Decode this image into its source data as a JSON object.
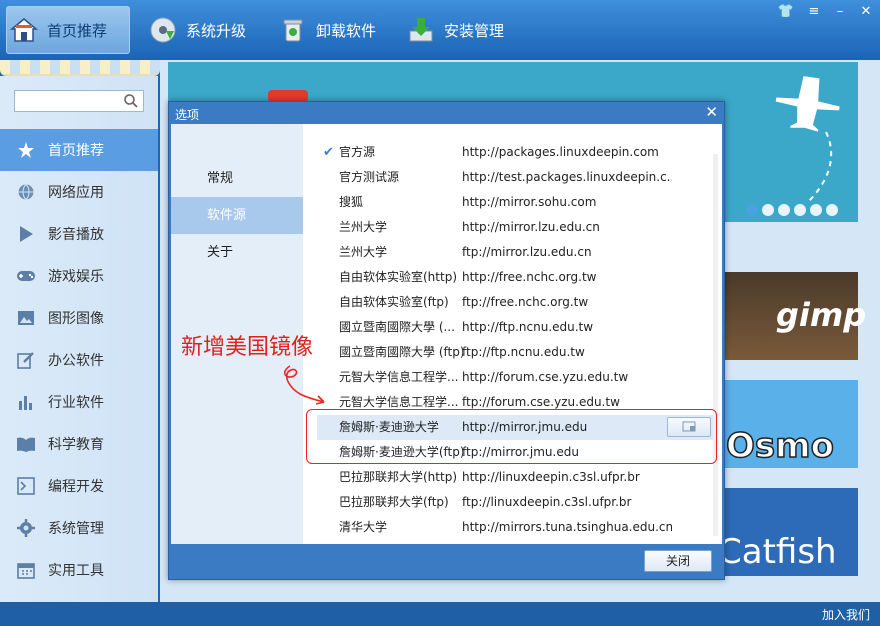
{
  "topbar": {
    "nav": [
      {
        "label": "首页推荐",
        "icon": "home-icon"
      },
      {
        "label": "系统升级",
        "icon": "disc-upgrade-icon"
      },
      {
        "label": "卸载软件",
        "icon": "trash-icon"
      },
      {
        "label": "安装管理",
        "icon": "download-icon"
      }
    ],
    "window_controls": [
      "shirt-icon",
      "menu-icon",
      "minimize-icon",
      "close-icon"
    ]
  },
  "sidebar": {
    "search": {
      "value": "",
      "placeholder": ""
    },
    "items": [
      {
        "label": "首页推荐",
        "icon": "star-icon",
        "active": true
      },
      {
        "label": "网络应用",
        "icon": "globe-icon"
      },
      {
        "label": "影音播放",
        "icon": "play-icon"
      },
      {
        "label": "游戏娱乐",
        "icon": "gamepad-icon"
      },
      {
        "label": "图形图像",
        "icon": "picture-icon"
      },
      {
        "label": "办公软件",
        "icon": "pen-icon"
      },
      {
        "label": "行业软件",
        "icon": "bar-chart-icon"
      },
      {
        "label": "科学教育",
        "icon": "book-icon"
      },
      {
        "label": "编程开发",
        "icon": "terminal-icon"
      },
      {
        "label": "系统管理",
        "icon": "gear-icon"
      },
      {
        "label": "实用工具",
        "icon": "calendar-icon"
      }
    ]
  },
  "thumbnails": [
    "gimp",
    "Osmo",
    "Catfish"
  ],
  "footer": {
    "join": "加入我们"
  },
  "dialog": {
    "title": "选项",
    "tabs": [
      {
        "label": "常规"
      },
      {
        "label": "软件源",
        "active": true
      },
      {
        "label": "关于"
      }
    ],
    "sources": [
      {
        "name": "官方源",
        "url": "http://packages.linuxdeepin.com",
        "checked": true
      },
      {
        "name": "官方测试源",
        "url": "http://test.packages.linuxdeepin.c..."
      },
      {
        "name": "搜狐",
        "url": "http://mirror.sohu.com"
      },
      {
        "name": "兰州大学",
        "url": "http://mirror.lzu.edu.cn"
      },
      {
        "name": "兰州大学",
        "url": "ftp://mirror.lzu.edu.cn"
      },
      {
        "name": "自由软体实验室(http)",
        "url": "http://free.nchc.org.tw"
      },
      {
        "name": "自由软体实验室(ftp)",
        "url": "ftp://free.nchc.org.tw"
      },
      {
        "name": "國立暨南國際大學 (...",
        "url": "http://ftp.ncnu.edu.tw"
      },
      {
        "name": "國立暨南國際大學 (ftp)",
        "url": "ftp://ftp.ncnu.edu.tw"
      },
      {
        "name": "元智大学信息工程学...",
        "url": "http://forum.cse.yzu.edu.tw"
      },
      {
        "name": "元智大学信息工程学...",
        "url": "ftp://forum.cse.yzu.edu.tw"
      },
      {
        "name": "詹姆斯·麦迪逊大学",
        "url": "http://mirror.jmu.edu",
        "selected": true
      },
      {
        "name": "詹姆斯·麦迪逊大学(ftp)",
        "url": "ftp://mirror.jmu.edu"
      },
      {
        "name": "巴拉那联邦大学(http)",
        "url": "http://linuxdeepin.c3sl.ufpr.br"
      },
      {
        "name": "巴拉那联邦大学(ftp)",
        "url": "ftp://linuxdeepin.c3sl.ufpr.br"
      },
      {
        "name": "清华大学",
        "url": "http://mirrors.tuna.tsinghua.edu.cn"
      }
    ],
    "close_label": "关闭"
  },
  "annotation": {
    "text": "新增美国镜像",
    "color": "#e0201e"
  }
}
